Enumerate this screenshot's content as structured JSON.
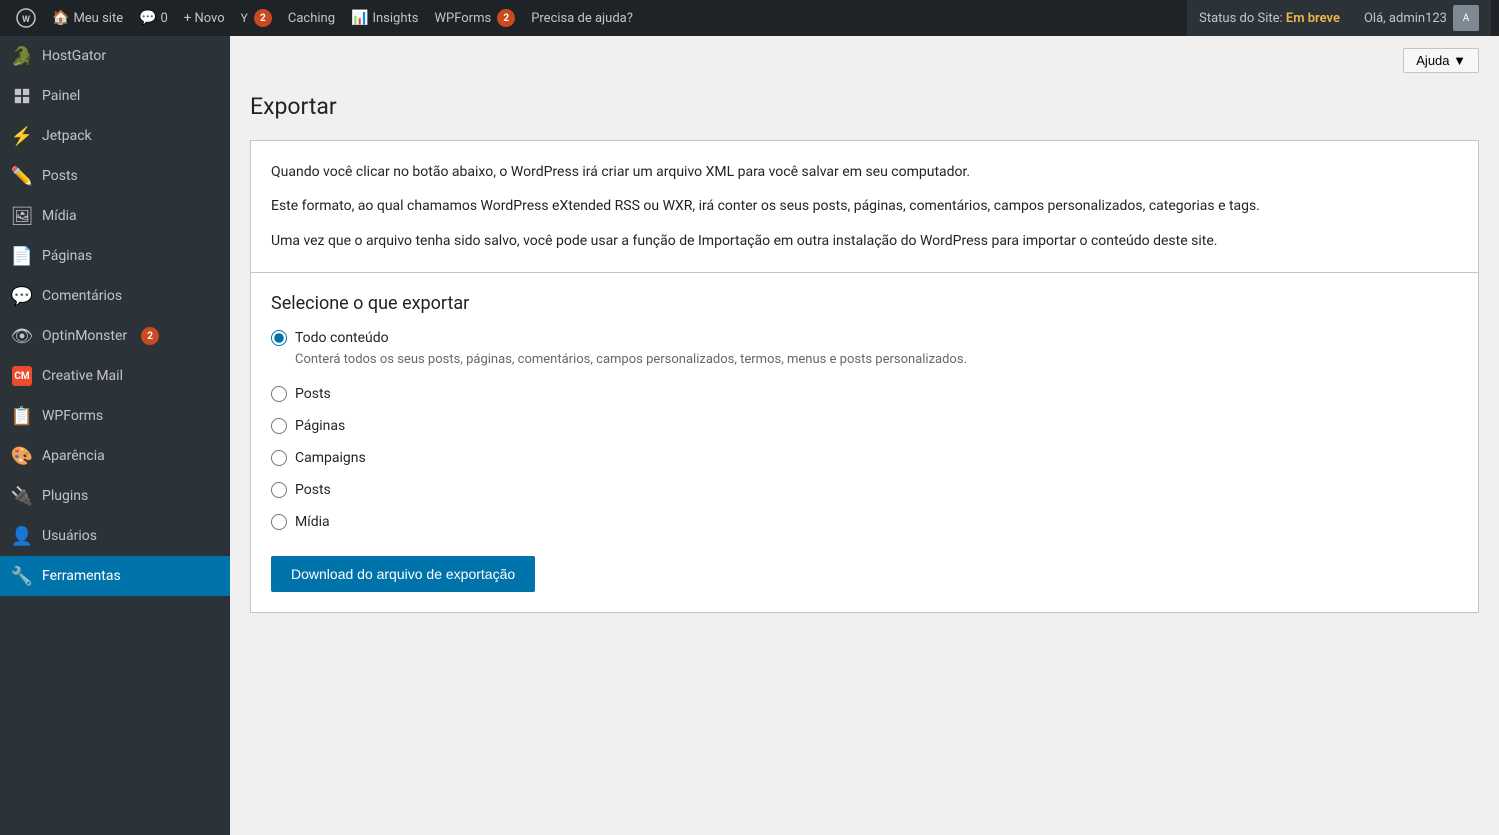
{
  "adminbar": {
    "wp_logo": "WP",
    "items": [
      {
        "id": "my-site",
        "label": "Meu site",
        "icon": "🏠"
      },
      {
        "id": "comments",
        "label": "0",
        "icon": "💬"
      },
      {
        "id": "new",
        "label": "+ Novo",
        "icon": ""
      },
      {
        "id": "yoast",
        "label": "",
        "badge": "2",
        "icon": "Y"
      },
      {
        "id": "caching",
        "label": "Caching",
        "icon": ""
      },
      {
        "id": "insights",
        "label": "Insights",
        "icon": "📊"
      },
      {
        "id": "wpforms",
        "label": "WPForms",
        "badge": "2",
        "icon": ""
      },
      {
        "id": "help",
        "label": "Precisa de ajuda?",
        "icon": ""
      }
    ],
    "status_label": "Status do Site:",
    "status_value": "Em breve",
    "user_label": "Olá, admin123"
  },
  "sidebar": {
    "items": [
      {
        "id": "hostgator",
        "label": "HostGator",
        "icon": "🐊"
      },
      {
        "id": "painel",
        "label": "Painel",
        "icon": "🏠"
      },
      {
        "id": "jetpack",
        "label": "Jetpack",
        "icon": "⚡"
      },
      {
        "id": "posts",
        "label": "Posts",
        "icon": "✏️"
      },
      {
        "id": "midia",
        "label": "Mídia",
        "icon": "🖼"
      },
      {
        "id": "paginas",
        "label": "Páginas",
        "icon": "📄"
      },
      {
        "id": "comentarios",
        "label": "Comentários",
        "icon": "💬"
      },
      {
        "id": "optinmonster",
        "label": "OptinMonster",
        "badge": "2",
        "icon": "👁"
      },
      {
        "id": "creativemail",
        "label": "Creative Mail",
        "icon": "CM"
      },
      {
        "id": "wpforms",
        "label": "WPForms",
        "icon": "📋"
      },
      {
        "id": "aparencia",
        "label": "Aparência",
        "icon": "🎨"
      },
      {
        "id": "plugins",
        "label": "Plugins",
        "icon": "🔌"
      },
      {
        "id": "usuarios",
        "label": "Usuários",
        "icon": "👤"
      },
      {
        "id": "ferramentas",
        "label": "Ferramentas",
        "icon": "🔧",
        "active": true
      }
    ]
  },
  "content": {
    "ajuda_label": "Ajuda ▼",
    "page_title": "Exportar",
    "intro_para1": "Quando você clicar no botão abaixo, o WordPress irá criar um arquivo XML para você salvar em seu computador.",
    "intro_para2": "Este formato, ao qual chamamos WordPress eXtended RSS ou WXR, irá conter os seus posts, páginas, comentários, campos personalizados, categorias e tags.",
    "intro_para3": "Uma vez que o arquivo tenha sido salvo, você pode usar a função de Importação em outra instalação do WordPress para importar o conteúdo deste site.",
    "section_title": "Selecione o que exportar",
    "options": [
      {
        "id": "todo",
        "label": "Todo conteúdo",
        "description": "Conterá todos os seus posts, páginas, comentários, campos personalizados, termos, menus e posts personalizados.",
        "checked": true
      },
      {
        "id": "posts",
        "label": "Posts",
        "description": "",
        "checked": false
      },
      {
        "id": "paginas",
        "label": "Páginas",
        "description": "",
        "checked": false
      },
      {
        "id": "campaigns",
        "label": "Campaigns",
        "description": "",
        "checked": false
      },
      {
        "id": "posts2",
        "label": "Posts",
        "description": "",
        "checked": false
      },
      {
        "id": "midia",
        "label": "Mídia",
        "description": "",
        "checked": false
      }
    ],
    "download_btn": "Download do arquivo de exportação"
  }
}
